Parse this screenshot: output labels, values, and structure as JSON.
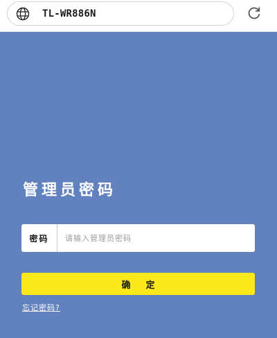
{
  "browser": {
    "url": "TL-WR886N",
    "site_icon": "globe-icon",
    "reload_icon": "reload-icon"
  },
  "login": {
    "title": "管理员密码",
    "password_label": "密码",
    "password_value": "",
    "password_placeholder": "请输入管理员密码",
    "confirm_label": "确定",
    "forgot_link": "忘记密码?"
  },
  "colors": {
    "background": "#6281bf",
    "confirm_button": "#fbe91c",
    "text_light": "#ffffff"
  }
}
